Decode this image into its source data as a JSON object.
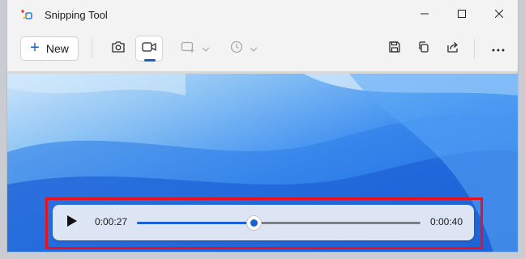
{
  "window": {
    "title": "Snipping Tool",
    "controls": {
      "minimize_icon": "minimize-icon",
      "maximize_icon": "maximize-icon",
      "close_icon": "close-icon"
    }
  },
  "toolbar": {
    "new_label": "New",
    "new_icon": "plus-icon",
    "mode_photo_icon": "camera-icon",
    "mode_video_icon": "video-camera-icon",
    "shape_icon": "rectangle-snip-icon",
    "delay_icon": "clock-icon",
    "save_icon": "save-icon",
    "copy_icon": "copy-icon",
    "share_icon": "share-icon",
    "more_icon": "more-icon"
  },
  "player": {
    "play_icon": "play-icon",
    "current_time": "0:00:27",
    "total_time": "0:00:40",
    "progress": 0.41
  },
  "colors": {
    "accent": "#1a63cf",
    "highlight": "#e8121e"
  }
}
